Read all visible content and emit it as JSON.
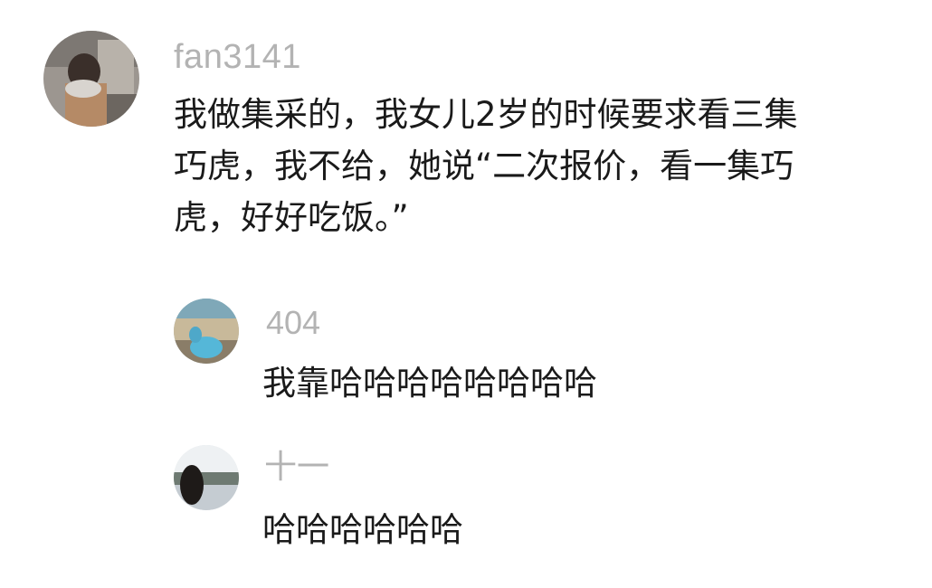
{
  "comments": [
    {
      "username": "fan3141",
      "lines": [
        "我做集采的，我女儿2岁的时候要求看三集",
        "巧虎，我不给，她说“二次报价，看一集巧",
        "虎，好好吃饭。”"
      ]
    },
    {
      "username": "404",
      "lines": [
        "我靠哈哈哈哈哈哈哈哈"
      ]
    },
    {
      "username": "十一",
      "lines": [
        "哈哈哈哈哈哈"
      ]
    }
  ],
  "colors": {
    "username": "#b3b3b3",
    "text": "#1a1a1a",
    "background": "#ffffff"
  }
}
